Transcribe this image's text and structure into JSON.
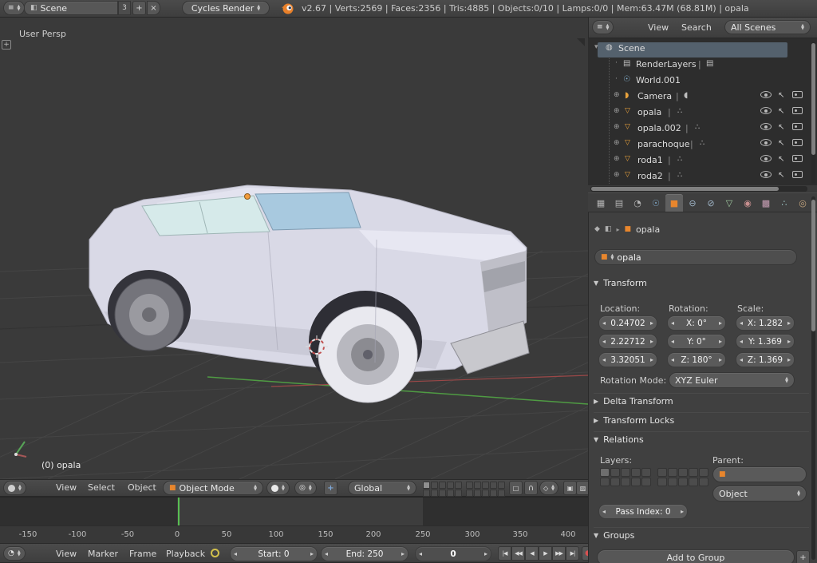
{
  "colors": {
    "accent_orange": "#e8862d",
    "selection_blue": "#54616d",
    "frame_marker_green": "#59bf52"
  },
  "info_header": {
    "scene_field": {
      "value": "Scene",
      "users": "3"
    },
    "engine_field": {
      "value": "Cycles Render"
    },
    "stats": "v2.67 | Verts:2569 | Faces:2356 | Tris:4885 | Objects:0/10 | Lamps:0/0 | Mem:63.47M (68.81M) | opala"
  },
  "viewport3d": {
    "view_label": "User Persp",
    "active_object": "(0) opala",
    "header": {
      "menus": [
        {
          "label": "View"
        },
        {
          "label": "Select"
        },
        {
          "label": "Object"
        }
      ],
      "mode_dropdown": "Object Mode",
      "orientation_dropdown": "Global"
    }
  },
  "outliner": {
    "header": {
      "menus": [
        {
          "label": "View"
        },
        {
          "label": "Search"
        }
      ],
      "display_dropdown": "All Scenes"
    },
    "items": [
      {
        "label": "Scene"
      },
      {
        "label": "RenderLayers"
      },
      {
        "label": "World.001"
      },
      {
        "label": "Camera"
      },
      {
        "label": "opala"
      },
      {
        "label": "opala.002"
      },
      {
        "label": "parachoque"
      },
      {
        "label": "roda1"
      },
      {
        "label": "roda2"
      }
    ]
  },
  "properties": {
    "breadcrumb_object": "opala",
    "name_field": "opala",
    "transform": {
      "title": "Transform",
      "location_label": "Location:",
      "rotation_label": "Rotation:",
      "scale_label": "Scale:",
      "location": [
        "0.24702",
        "2.22712",
        "3.32051"
      ],
      "rotation": [
        "X: 0°",
        "Y: 0°",
        "Z: 180°"
      ],
      "scale": [
        "X: 1.282",
        "Y: 1.369",
        "Z: 1.369"
      ],
      "rotation_mode_label": "Rotation Mode:",
      "rotation_mode_value": "XYZ Euler"
    },
    "delta_transform_title": "Delta Transform",
    "transform_locks_title": "Transform Locks",
    "relations": {
      "title": "Relations",
      "layers_label": "Layers:",
      "parent_label": "Parent:",
      "parent_type_value": "Object",
      "pass_index_field": "Pass Index: 0"
    },
    "groups": {
      "title": "Groups",
      "add_button": "Add to Group"
    }
  },
  "timeline": {
    "header": {
      "menus": [
        {
          "label": "View"
        },
        {
          "label": "Marker"
        },
        {
          "label": "Frame"
        },
        {
          "label": "Playback"
        }
      ],
      "start_field": "Start: 0",
      "end_field": "End: 250",
      "current_frame": "0"
    },
    "ruler": [
      "-150",
      "-100",
      "-50",
      "0",
      "50",
      "100",
      "150",
      "200",
      "250",
      "300",
      "350",
      "400"
    ]
  }
}
